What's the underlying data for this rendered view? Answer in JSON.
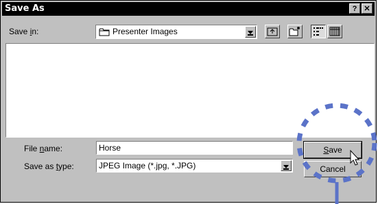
{
  "window": {
    "title": "Save As",
    "help_label": "?",
    "close_label": "✕"
  },
  "save_in": {
    "label_pre": "Save ",
    "label_key": "i",
    "label_post": "n:",
    "value": "Presenter Images"
  },
  "file_name": {
    "label_pre": "File ",
    "label_key": "n",
    "label_post": "ame:",
    "value": "Horse"
  },
  "save_as_type": {
    "label_pre": "Save as ",
    "label_key": "t",
    "label_post": "ype:",
    "value": "JPEG Image (*.jpg, *.JPG)"
  },
  "buttons": {
    "save_key": "S",
    "save_rest": "ave",
    "cancel": "Cancel"
  },
  "icons": [
    "folder-icon",
    "up-folder-icon",
    "new-folder-icon",
    "list-view-icon",
    "details-view-icon",
    "cursor-icon"
  ],
  "colors": {
    "face": "#c0c0c0",
    "titlebar": "#000000",
    "highlight": "#5b73c8"
  }
}
